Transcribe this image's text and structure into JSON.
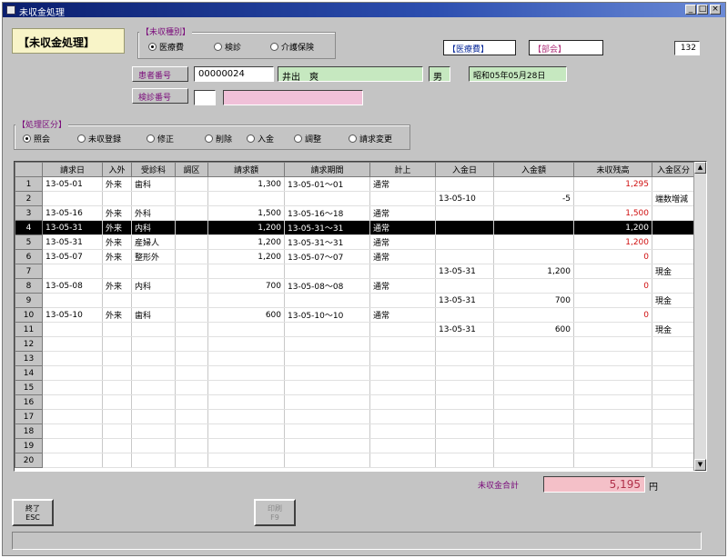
{
  "window": {
    "title": "未収金処理",
    "min": "_",
    "max": "□",
    "close": "×"
  },
  "panel_title": "【未収金処理】",
  "unpaid_type": {
    "label": "【未収種別】",
    "options": [
      "医療費",
      "検診",
      "介護保険"
    ],
    "selected": 0
  },
  "header_boxes": {
    "insurer": "【医療費】",
    "dept": "【部会】",
    "page_value": "132"
  },
  "patient": {
    "number_label": "患者番号",
    "number": "00000024",
    "name": "井出　爽",
    "sex": "男",
    "birth": "昭和05年05月28日"
  },
  "exam": {
    "label": "検診番号",
    "code": "",
    "name": ""
  },
  "process": {
    "label": "【処理区分】",
    "options": [
      "照会",
      "未収登録",
      "修正",
      "削除",
      "入金",
      "調整",
      "請求変更"
    ],
    "selected": 0
  },
  "grid": {
    "columns": [
      "請求日",
      "入外",
      "受診科",
      "調区",
      "請求額",
      "請求期間",
      "計上",
      "入金日",
      "入金額",
      "未収残高",
      "入金区分"
    ],
    "rows": [
      {
        "n": "1",
        "date": "13-05-01",
        "io": "外来",
        "dept": "歯科",
        "adj": "",
        "amount": "1,300",
        "period": "13-05-01～01",
        "posted": "通常",
        "pdate": "",
        "paid": "",
        "balance": "1,295",
        "bal_color": "red",
        "ptype": ""
      },
      {
        "n": "2",
        "date": "",
        "io": "",
        "dept": "",
        "adj": "",
        "amount": "",
        "period": "",
        "posted": "",
        "pdate": "13-05-10",
        "paid": "-5",
        "balance": "",
        "bal_color": "",
        "ptype": "端数増減"
      },
      {
        "n": "3",
        "date": "13-05-16",
        "io": "外来",
        "dept": "外科",
        "adj": "",
        "amount": "1,500",
        "period": "13-05-16～18",
        "posted": "通常",
        "pdate": "",
        "paid": "",
        "balance": "1,500",
        "bal_color": "red",
        "ptype": ""
      },
      {
        "n": "4",
        "date": "13-05-31",
        "io": "外来",
        "dept": "内科",
        "adj": "",
        "amount": "1,200",
        "period": "13-05-31～31",
        "posted": "通常",
        "pdate": "",
        "paid": "",
        "balance": "1,200",
        "bal_color": "green",
        "ptype": ""
      },
      {
        "n": "5",
        "date": "13-05-31",
        "io": "外来",
        "dept": "産婦人",
        "adj": "",
        "amount": "1,200",
        "period": "13-05-31～31",
        "posted": "通常",
        "pdate": "",
        "paid": "",
        "balance": "1,200",
        "bal_color": "red",
        "ptype": ""
      },
      {
        "n": "6",
        "date": "13-05-07",
        "io": "外来",
        "dept": "整形外",
        "adj": "",
        "amount": "1,200",
        "period": "13-05-07～07",
        "posted": "通常",
        "pdate": "",
        "paid": "",
        "balance": "0",
        "bal_color": "red",
        "ptype": ""
      },
      {
        "n": "7",
        "date": "",
        "io": "",
        "dept": "",
        "adj": "",
        "amount": "",
        "period": "",
        "posted": "",
        "pdate": "13-05-31",
        "paid": "1,200",
        "balance": "",
        "bal_color": "",
        "ptype": "現金"
      },
      {
        "n": "8",
        "date": "13-05-08",
        "io": "外来",
        "dept": "内科",
        "adj": "",
        "amount": "700",
        "period": "13-05-08～08",
        "posted": "通常",
        "pdate": "",
        "paid": "",
        "balance": "0",
        "bal_color": "red",
        "ptype": ""
      },
      {
        "n": "9",
        "date": "",
        "io": "",
        "dept": "",
        "adj": "",
        "amount": "",
        "period": "",
        "posted": "",
        "pdate": "13-05-31",
        "paid": "700",
        "balance": "",
        "bal_color": "",
        "ptype": "現金"
      },
      {
        "n": "10",
        "date": "13-05-10",
        "io": "外来",
        "dept": "歯科",
        "adj": "",
        "amount": "600",
        "period": "13-05-10～10",
        "posted": "通常",
        "pdate": "",
        "paid": "",
        "balance": "0",
        "bal_color": "red",
        "ptype": ""
      },
      {
        "n": "11",
        "date": "",
        "io": "",
        "dept": "",
        "adj": "",
        "amount": "",
        "period": "",
        "posted": "",
        "pdate": "13-05-31",
        "paid": "600",
        "balance": "",
        "bal_color": "",
        "ptype": "現金"
      },
      {
        "n": "12"
      },
      {
        "n": "13"
      },
      {
        "n": "14"
      },
      {
        "n": "15"
      },
      {
        "n": "16"
      },
      {
        "n": "17"
      },
      {
        "n": "18"
      },
      {
        "n": "19"
      },
      {
        "n": "20"
      }
    ],
    "selected_row": 3
  },
  "totals": {
    "label": "未収金合計",
    "value": "5,195",
    "unit": "円"
  },
  "buttons": {
    "end_line1": "終了",
    "end_line2": "ESC",
    "print_line1": "印刷",
    "print_line2": "F9"
  },
  "colors": {
    "title_bar": "#0a1e6e",
    "pink_field": "#f4c0c8",
    "green_field": "#c6e8c0"
  }
}
